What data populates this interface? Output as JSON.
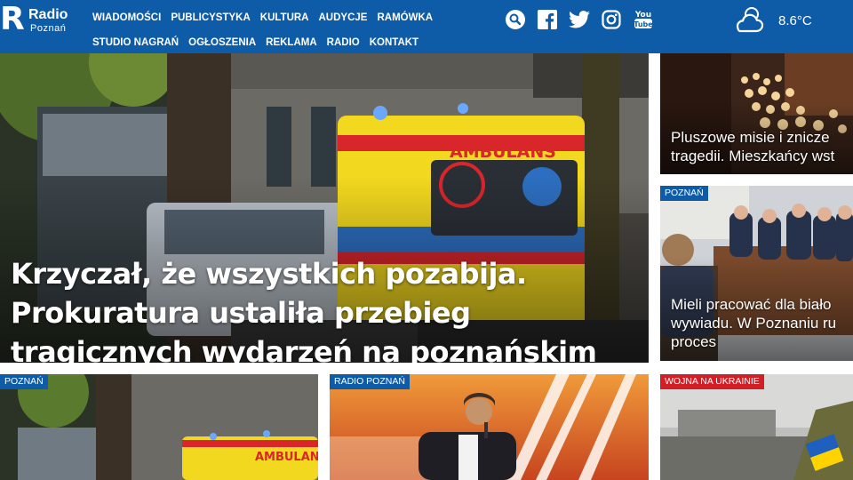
{
  "brand": {
    "letter": "R",
    "name": "Radio",
    "city": "Poznań"
  },
  "nav": {
    "row1": [
      "WIADOMOŚCI",
      "PUBLICYSTYKA",
      "KULTURA",
      "AUDYCJE",
      "RAMÓWKA"
    ],
    "row2": [
      "STUDIO NAGRAŃ",
      "OGŁOSZENIA",
      "REKLAMA",
      "RADIO",
      "KONTAKT"
    ]
  },
  "social": [
    "search-icon",
    "facebook-icon",
    "twitter-icon",
    "instagram-icon",
    "youtube-icon"
  ],
  "youtube_label": {
    "top": "You",
    "bottom": "Tube"
  },
  "weather": {
    "icon": "cloud-icon",
    "temperature": "8.6°C"
  },
  "main_article": {
    "title": "Krzyczał, że wszystkich pozabija. Prokuratura ustaliła przebieg tragicznych wydarzeń na poznańskim Łazarzu",
    "ambulance_text": "AMBULANS"
  },
  "side_articles": [
    {
      "tag": "",
      "title_line1": "Pluszowe misie i znicze",
      "title_line2": "tragedii. Mieszkańcy wst"
    },
    {
      "tag": "POZNAŃ",
      "title_line1": "Mieli pracować dla biało",
      "title_line2": "wywiadu. W Poznaniu ru",
      "title_line3": "proces"
    }
  ],
  "bottom_articles": [
    {
      "tag": "POZNAŃ",
      "ambulance_text": "AMBULANS"
    },
    {
      "tag": "RADIO POZNAŃ"
    },
    {
      "tag": "WOJNA NA UKRAINIE"
    }
  ],
  "colors": {
    "brand_blue": "#0e5ca8",
    "tag_red": "#d21f26",
    "ambulance_yellow": "#f2d81f",
    "ambulance_red": "#d9262b"
  }
}
